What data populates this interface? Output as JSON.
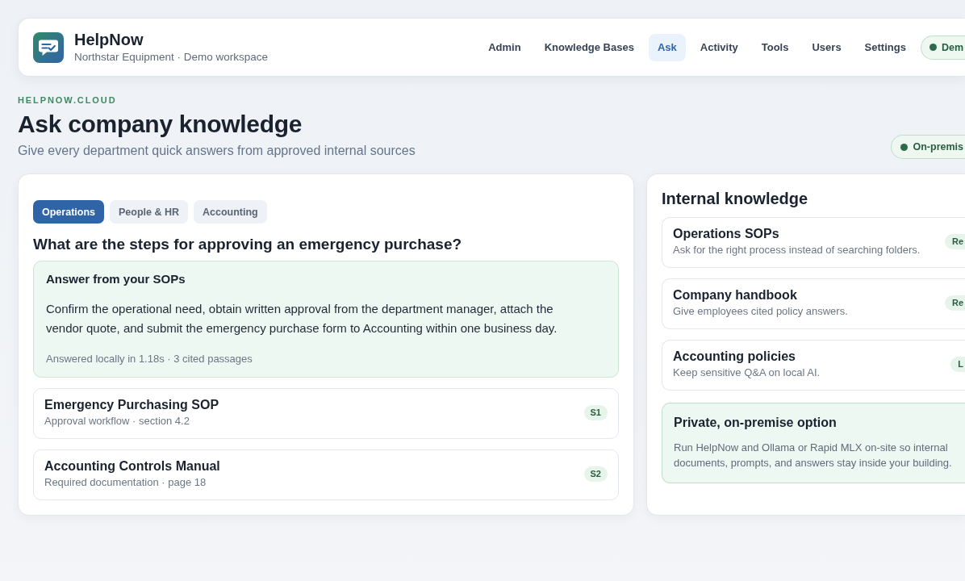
{
  "header": {
    "brand": "HelpNow",
    "subtitle": "Northstar Equipment · Demo workspace",
    "nav": [
      {
        "label": "Admin",
        "selected": false
      },
      {
        "label": "Knowledge Bases",
        "selected": false
      },
      {
        "label": "Ask",
        "selected": true
      },
      {
        "label": "Activity",
        "selected": false
      },
      {
        "label": "Tools",
        "selected": false
      },
      {
        "label": "Users",
        "selected": false
      },
      {
        "label": "Settings",
        "selected": false
      }
    ],
    "workspace_badge": "Dem"
  },
  "intro": {
    "eyebrow": "HELPNOW.CLOUD",
    "title": "Ask company knowledge",
    "subtitle": "Give every department quick answers from approved internal sources",
    "deployment_badge": "On-premis"
  },
  "ask_panel": {
    "tabs": [
      {
        "label": "Operations",
        "selected": true
      },
      {
        "label": "People & HR",
        "selected": false
      },
      {
        "label": "Accounting",
        "selected": false
      }
    ],
    "question": "What are the steps for approving an emergency purchase?",
    "answer": {
      "title": "Answer from your SOPs",
      "text": "Confirm the operational need, obtain written approval from the department manager, attach the vendor quote, and submit the emergency purchase form to Accounting within one business day.",
      "meta": "Answered locally in 1.18s · 3 cited passages"
    },
    "sources": [
      {
        "title": "Emergency Purchasing SOP",
        "detail": "Approval workflow · section 4.2",
        "badge": "S1"
      },
      {
        "title": "Accounting Controls Manual",
        "detail": "Required documentation · page 18",
        "badge": "S2"
      }
    ]
  },
  "knowledge_panel": {
    "title": "Internal knowledge",
    "items": [
      {
        "title": "Operations SOPs",
        "description": "Ask for the right process instead of searching folders.",
        "badge": "Re"
      },
      {
        "title": "Company handbook",
        "description": "Give employees cited policy answers.",
        "badge": "Re"
      },
      {
        "title": "Accounting policies",
        "description": "Keep sensitive Q&A on local AI.",
        "badge": "L"
      }
    ],
    "callout": {
      "title": "Private, on-premise option",
      "text": "Run HelpNow and Ollama or Rapid MLX on-site so internal documents, prompts, and answers stay inside your building."
    }
  }
}
